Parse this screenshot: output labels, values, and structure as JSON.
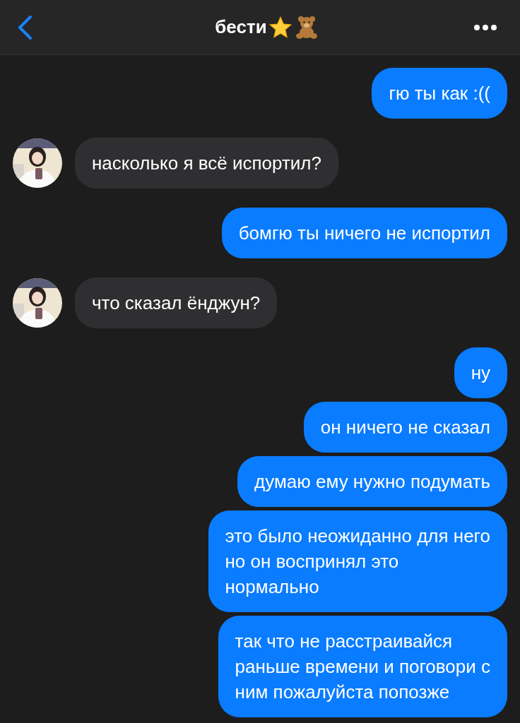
{
  "header": {
    "title": "бести"
  },
  "messages": [
    {
      "kind": "sent",
      "text": "гю ты как :(("
    },
    {
      "kind": "received",
      "text": "насколько я всё испортил?"
    },
    {
      "kind": "sent",
      "text": "бомгю ты ничего не испортил"
    },
    {
      "kind": "received",
      "text": "что сказал ёнджун?"
    },
    {
      "kind": "sent",
      "text": "ну"
    },
    {
      "kind": "sent",
      "text": "он ничего не сказал"
    },
    {
      "kind": "sent",
      "text": "думаю ему нужно подумать"
    },
    {
      "kind": "sent",
      "text": "это было неожиданно для него\nно он воспринял это\nнормально"
    },
    {
      "kind": "sent",
      "text": "так что не расстраивайся\nраньше времени и поговори с\nним пожалуйста попозже"
    }
  ]
}
